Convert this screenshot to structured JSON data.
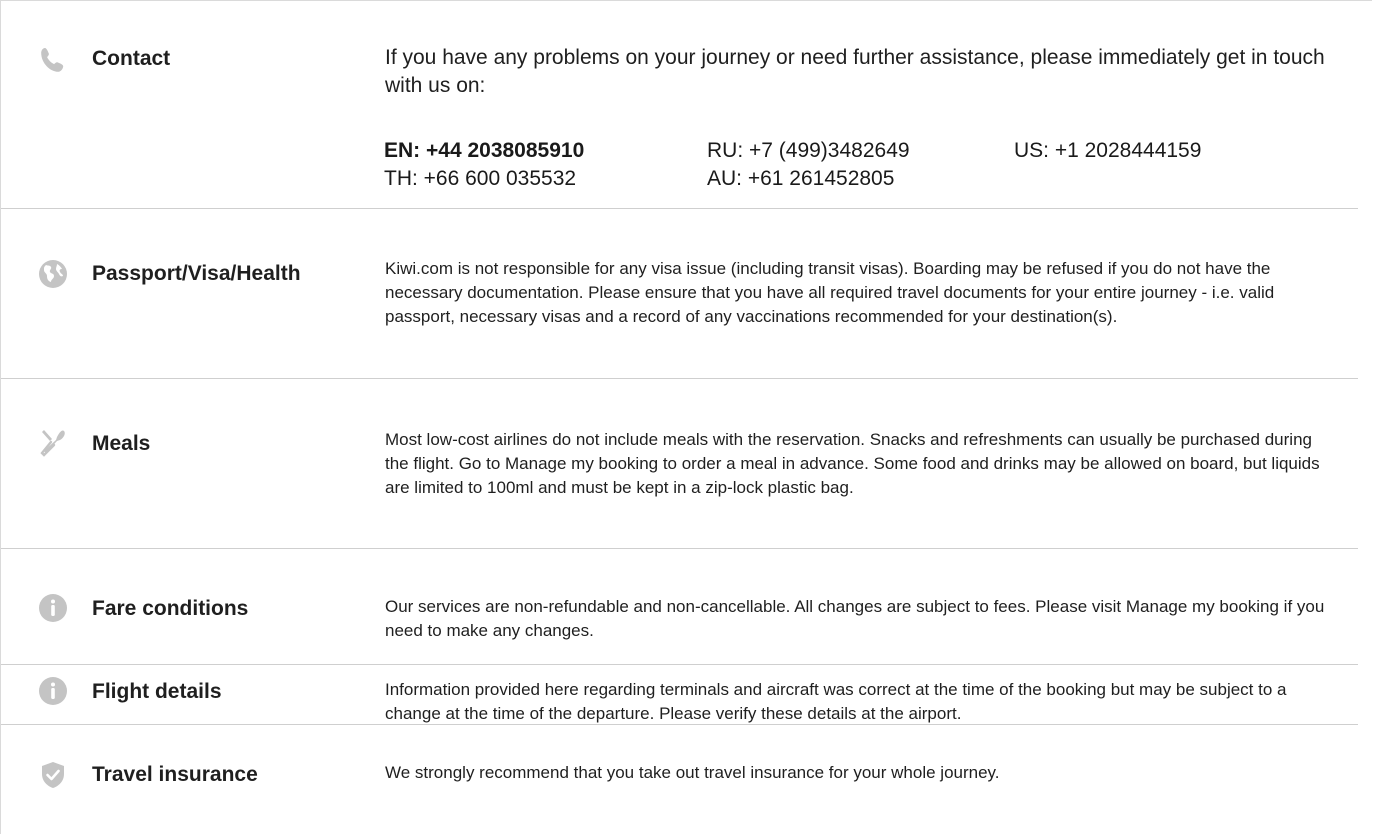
{
  "sections": [
    {
      "id": "contact",
      "icon": "phone-icon",
      "label": "Contact",
      "text": "If you have any problems on your journey or need further assistance, please immediately get in touch with us on:",
      "phones": [
        "EN: +44 2038085910",
        "RU: +7 (499)3482649",
        "US: +1 2028444159",
        "TH: +66 600 035532",
        "AU: +61 261452805"
      ]
    },
    {
      "id": "passport",
      "icon": "globe-icon",
      "label": "Passport/Visa/Health",
      "text": "Kiwi.com is not responsible for any visa issue (including transit visas). Boarding may be refused if you do not have the necessary documentation. Please ensure that you have all required travel documents for your entire journey - i.e. valid passport, necessary visas and a record of any vaccinations recommended for your destination(s)."
    },
    {
      "id": "meals",
      "icon": "cutlery-icon",
      "label": "Meals",
      "text": "Most low-cost airlines do not include meals with the reservation. Snacks and refreshments can usually be purchased during the flight. Go to Manage my booking to order a meal in advance. Some food and drinks may be allowed on board, but liquids are limited to 100ml and must be kept in a zip-lock plastic bag."
    },
    {
      "id": "fare",
      "icon": "info-icon",
      "label": "Fare conditions",
      "text": "Our services are non-refundable and non-cancellable. All changes are subject to fees. Please visit Manage my booking if you need to make any changes."
    },
    {
      "id": "flight",
      "icon": "info-icon",
      "label": "Flight details",
      "text": "Information provided here regarding terminals and aircraft was correct at the time of the booking but may be subject to a change at the time of the departure. Please verify these details at the airport."
    },
    {
      "id": "insurance",
      "icon": "shield-check-icon",
      "label": "Travel insurance",
      "text": "We strongly recommend that you take out travel insurance for your whole journey."
    }
  ],
  "colors": {
    "icon": "#c4c4c4",
    "text": "#1f1f1f",
    "divider": "#cfcfcf"
  }
}
